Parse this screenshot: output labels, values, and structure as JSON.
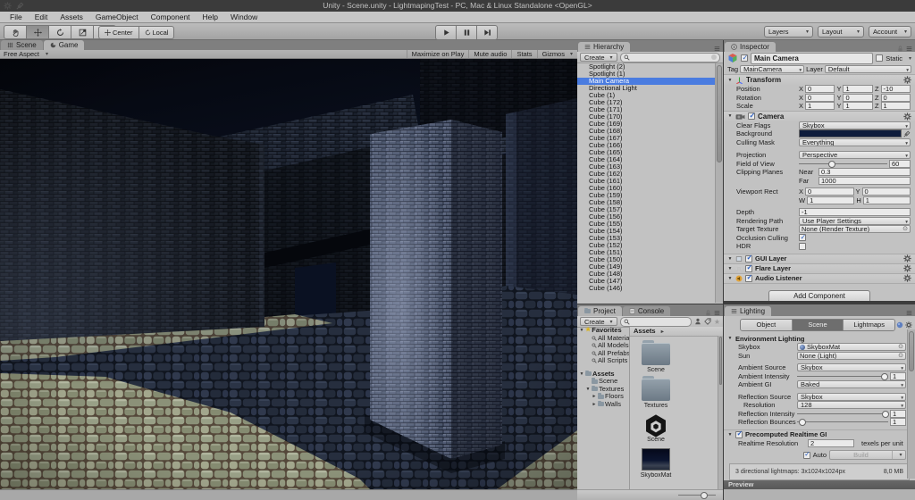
{
  "title_bar": {
    "title": "Unity - Scene.unity - LightmapingTest - PC, Mac & Linux Standalone <OpenGL>"
  },
  "menu_bar": {
    "items": [
      "File",
      "Edit",
      "Assets",
      "GameObject",
      "Component",
      "Help",
      "Window"
    ]
  },
  "toolbar": {
    "center_label": "Center",
    "local_label": "Local",
    "layers_label": "Layers",
    "layout_label": "Layout",
    "account_label": "Account"
  },
  "view_tabs": {
    "scene": "Scene",
    "game": "Game"
  },
  "game_toolbar": {
    "aspect": "Free Aspect",
    "maximize_label": "Maximize on Play",
    "mute_label": "Mute audio",
    "stats_label": "Stats",
    "gizmos_label": "Gizmos"
  },
  "hierarchy": {
    "tab": "Hierarchy",
    "create_label": "Create",
    "items": [
      {
        "label": "Spotlight (2)",
        "selected": false
      },
      {
        "label": "Spotlight (1)",
        "selected": false
      },
      {
        "label": "Main Camera",
        "selected": true
      },
      {
        "label": "Directional Light",
        "selected": false
      },
      {
        "label": "Cube (1)",
        "selected": false
      },
      {
        "label": "Cube (172)",
        "selected": false
      },
      {
        "label": "Cube (171)",
        "selected": false
      },
      {
        "label": "Cube (170)",
        "selected": false
      },
      {
        "label": "Cube (169)",
        "selected": false
      },
      {
        "label": "Cube (168)",
        "selected": false
      },
      {
        "label": "Cube (167)",
        "selected": false
      },
      {
        "label": "Cube (166)",
        "selected": false
      },
      {
        "label": "Cube (165)",
        "selected": false
      },
      {
        "label": "Cube (164)",
        "selected": false
      },
      {
        "label": "Cube (163)",
        "selected": false
      },
      {
        "label": "Cube (162)",
        "selected": false
      },
      {
        "label": "Cube (161)",
        "selected": false
      },
      {
        "label": "Cube (160)",
        "selected": false
      },
      {
        "label": "Cube (159)",
        "selected": false
      },
      {
        "label": "Cube (158)",
        "selected": false
      },
      {
        "label": "Cube (157)",
        "selected": false
      },
      {
        "label": "Cube (156)",
        "selected": false
      },
      {
        "label": "Cube (155)",
        "selected": false
      },
      {
        "label": "Cube (154)",
        "selected": false
      },
      {
        "label": "Cube (153)",
        "selected": false
      },
      {
        "label": "Cube (152)",
        "selected": false
      },
      {
        "label": "Cube (151)",
        "selected": false
      },
      {
        "label": "Cube (150)",
        "selected": false
      },
      {
        "label": "Cube (149)",
        "selected": false
      },
      {
        "label": "Cube (148)",
        "selected": false
      },
      {
        "label": "Cube (147)",
        "selected": false
      },
      {
        "label": "Cube (146)",
        "selected": false
      }
    ]
  },
  "project": {
    "tab": "Project",
    "console_tab": "Console",
    "create_label": "Create",
    "breadcrumb": "Assets",
    "tree": [
      {
        "label": "Favorites",
        "icon": "star",
        "fold": "open",
        "depth": 0,
        "bold": true
      },
      {
        "label": "All Materials",
        "icon": "search",
        "fold": "none",
        "depth": 1,
        "bold": false
      },
      {
        "label": "All Models",
        "icon": "search",
        "fold": "none",
        "depth": 1,
        "bold": false
      },
      {
        "label": "All Prefabs",
        "icon": "search",
        "fold": "none",
        "depth": 1,
        "bold": false
      },
      {
        "label": "All Scripts",
        "icon": "search",
        "fold": "none",
        "depth": 1,
        "bold": false
      },
      {
        "spacer": true
      },
      {
        "label": "Assets",
        "icon": "folder",
        "fold": "open",
        "depth": 0,
        "bold": true
      },
      {
        "label": "Scene",
        "icon": "folder",
        "fold": "none",
        "depth": 1,
        "bold": false
      },
      {
        "label": "Textures",
        "icon": "folder",
        "fold": "open",
        "depth": 1,
        "bold": false
      },
      {
        "label": "Floors",
        "icon": "folder",
        "fold": "closed",
        "depth": 2,
        "bold": false
      },
      {
        "label": "Walls",
        "icon": "folder",
        "fold": "closed",
        "depth": 2,
        "bold": false
      }
    ],
    "grid": [
      {
        "label": "Scene",
        "icon": "folder"
      },
      {
        "label": "Textures",
        "icon": "folder"
      },
      {
        "label": "Scene",
        "icon": "unity"
      },
      {
        "label": "SkyboxMat",
        "icon": "skybox"
      }
    ]
  },
  "inspector": {
    "tab": "Inspector",
    "header": {
      "name": "Main Camera",
      "static_label": "Static",
      "tag_label": "Tag",
      "tag_value": "MainCamera",
      "layer_label": "Layer",
      "layer_value": "Default"
    },
    "transform": {
      "title": "Transform",
      "axes": [
        "X",
        "Y",
        "Z"
      ],
      "rows": [
        {
          "label": "Position",
          "values": [
            "0",
            "1",
            "-10"
          ]
        },
        {
          "label": "Rotation",
          "values": [
            "0",
            "0",
            "0"
          ]
        },
        {
          "label": "Scale",
          "values": [
            "1",
            "1",
            "1"
          ]
        }
      ]
    },
    "camera": {
      "title": "Camera",
      "clear_flags_label": "Clear Flags",
      "clear_flags": "Skybox",
      "background_label": "Background",
      "culling_mask_label": "Culling Mask",
      "culling_mask": "Everything",
      "projection_label": "Projection",
      "projection": "Perspective",
      "fov_label": "Field of View",
      "fov": "60",
      "clipping_label": "Clipping Planes",
      "near_label": "Near",
      "near": "0.3",
      "far_label": "Far",
      "far": "1000",
      "viewport_label": "Viewport Rect",
      "vx": "0",
      "vy": "0",
      "vw": "1",
      "vh": "1",
      "depth_label": "Depth",
      "depth": "-1",
      "rendering_path_label": "Rendering Path",
      "rendering_path": "Use Player Settings",
      "target_texture_label": "Target Texture",
      "target_texture": "None (Render Texture)",
      "occlusion_label": "Occlusion Culling",
      "hdr_label": "HDR"
    },
    "components": [
      "GUI Layer",
      "Flare Layer",
      "Audio Listener"
    ],
    "add_component_label": "Add Component"
  },
  "lighting": {
    "tab": "Lighting",
    "modes": [
      "Object",
      "Scene",
      "Lightmaps"
    ],
    "active_mode": "Scene",
    "env_title": "Environment Lighting",
    "skybox_label": "Skybox",
    "skybox": "SkyboxMat",
    "sun_label": "Sun",
    "sun": "None (Light)",
    "ambient_source_label": "Ambient Source",
    "ambient_source": "Skybox",
    "ambient_intensity_label": "Ambient Intensity",
    "ambient_intensity": "1",
    "ambient_gi_label": "Ambient GI",
    "ambient_gi": "Baked",
    "reflection_source_label": "Reflection Source",
    "reflection_source": "Skybox",
    "resolution_label": "Resolution",
    "resolution": "128",
    "reflection_intensity_label": "Reflection Intensity",
    "reflection_intensity": "1",
    "reflection_bounces_label": "Reflection Bounces",
    "reflection_bounces": "1",
    "gi_title": "Precomputed Realtime GI",
    "realtime_resolution_label": "Realtime Resolution",
    "realtime_resolution": "2",
    "texels_label": "texels per unit",
    "auto_label": "Auto",
    "build_label": "Build",
    "status_text": "3 directional lightmaps: 3x1024x1024px",
    "status_size": "8,0 MB",
    "preview_label": "Preview"
  },
  "colors": {
    "selection": "#4a7ce0",
    "camera_background": "#0e1c3c"
  }
}
